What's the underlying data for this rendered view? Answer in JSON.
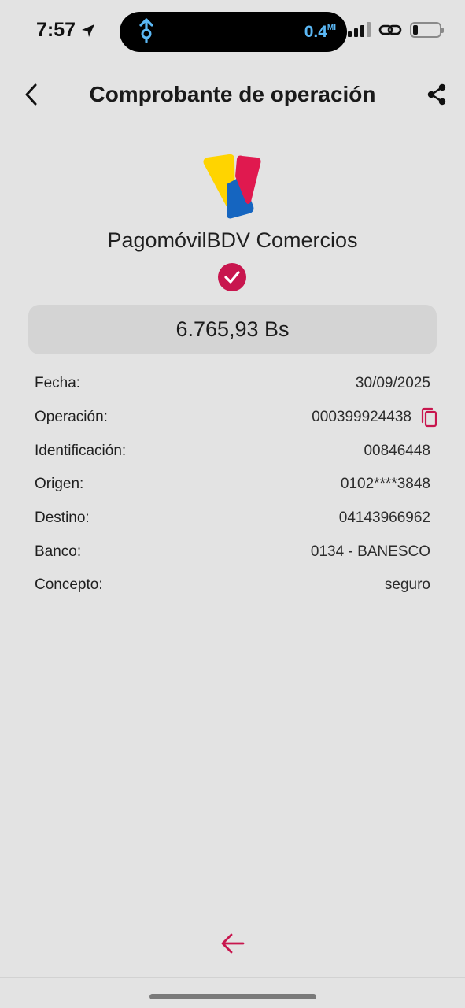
{
  "status_bar": {
    "time": "7:57",
    "activity_distance": "0.4",
    "activity_unit": "MI"
  },
  "header": {
    "title": "Comprobante de operación"
  },
  "brand": {
    "name": "PagomóvilBDV Comercios",
    "logo_colors": [
      "#ffd400",
      "#1565c0",
      "#e0194f"
    ]
  },
  "receipt": {
    "amount": "6.765,93 Bs",
    "rows": [
      {
        "label": "Fecha:",
        "value": "30/09/2025"
      },
      {
        "label": "Operación:",
        "value": "000399924438"
      },
      {
        "label": "Identificación:",
        "value": "00846448"
      },
      {
        "label": "Origen:",
        "value": "0102****3848"
      },
      {
        "label": "Destino:",
        "value": "04143966962"
      },
      {
        "label": "Banco:",
        "value": "0134 - BANESCO"
      },
      {
        "label": "Concepto:",
        "value": "seguro"
      }
    ]
  },
  "colors": {
    "accent": "#c8164e",
    "background": "#e3e3e3",
    "amount_box": "#d4d4d4"
  },
  "icons": [
    "location-arrow-icon",
    "walking-icon",
    "signal-icon",
    "link-icon",
    "battery-icon",
    "back-chevron-icon",
    "share-icon",
    "check-icon",
    "copy-icon",
    "arrow-left-icon"
  ]
}
